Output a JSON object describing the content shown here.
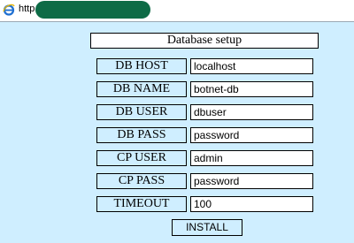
{
  "address_bar": {
    "url_prefix": "http"
  },
  "form": {
    "title": "Database setup",
    "fields": [
      {
        "label": "DB HOST",
        "value": "localhost"
      },
      {
        "label": "DB NAME",
        "value": "botnet-db"
      },
      {
        "label": "DB USER",
        "value": "dbuser"
      },
      {
        "label": "DB PASS",
        "value": "password"
      },
      {
        "label": "CP USER",
        "value": "admin"
      },
      {
        "label": "CP PASS",
        "value": "password"
      },
      {
        "label": "TIMEOUT",
        "value": "100"
      }
    ],
    "install_label": "INSTALL"
  },
  "colors": {
    "page_background": "#cfeeff",
    "url_redaction": "#0e6b46",
    "ie_icon": "#1f6fd1"
  }
}
